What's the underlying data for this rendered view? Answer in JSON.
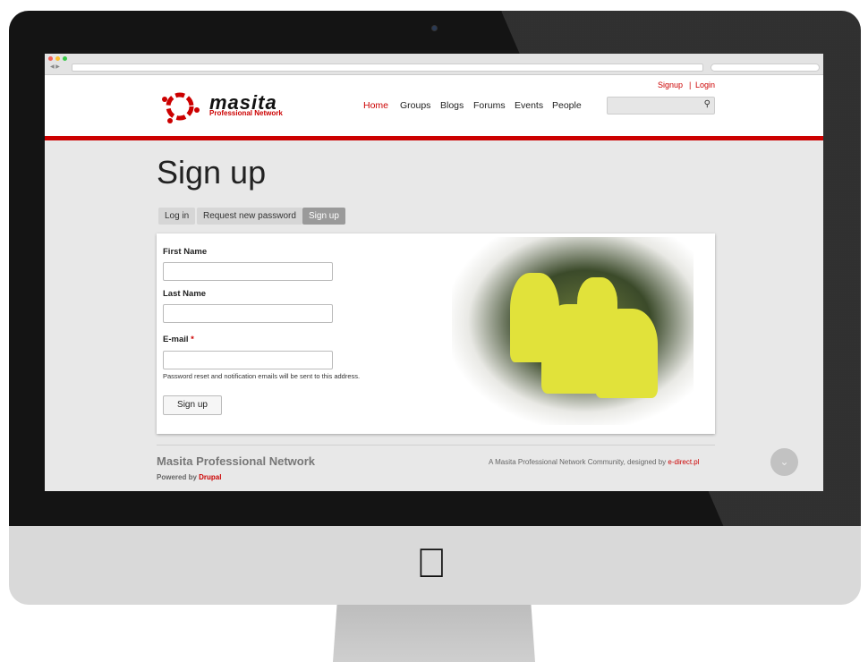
{
  "header": {
    "top_links": [
      "Signup",
      "Login"
    ],
    "logo_word": "masita",
    "logo_sub": "Professional Network",
    "nav": [
      "Home",
      "Groups",
      "Blogs",
      "Forums",
      "Events",
      "People"
    ],
    "active_nav": "Home",
    "search_icon": "magnifier-icon"
  },
  "page": {
    "title": "Sign up",
    "tabs": [
      "Log in",
      "Request new password",
      "Sign up"
    ],
    "active_tab": "Sign up"
  },
  "form": {
    "first_name_label": "First Name",
    "last_name_label": "Last Name",
    "email_label": "E-mail",
    "required_mark": "*",
    "email_description": "Password reset and notification emails will be sent to this address.",
    "submit_label": "Sign up"
  },
  "footer": {
    "title": "Masita Professional Network",
    "powered_prefix": "Powered by",
    "powered_link": "Drupal",
    "credit_prefix": "A Masita Professional Network Community, designed by",
    "credit_link": "e-direct.pl"
  },
  "colors": {
    "accent": "#cc0000"
  }
}
